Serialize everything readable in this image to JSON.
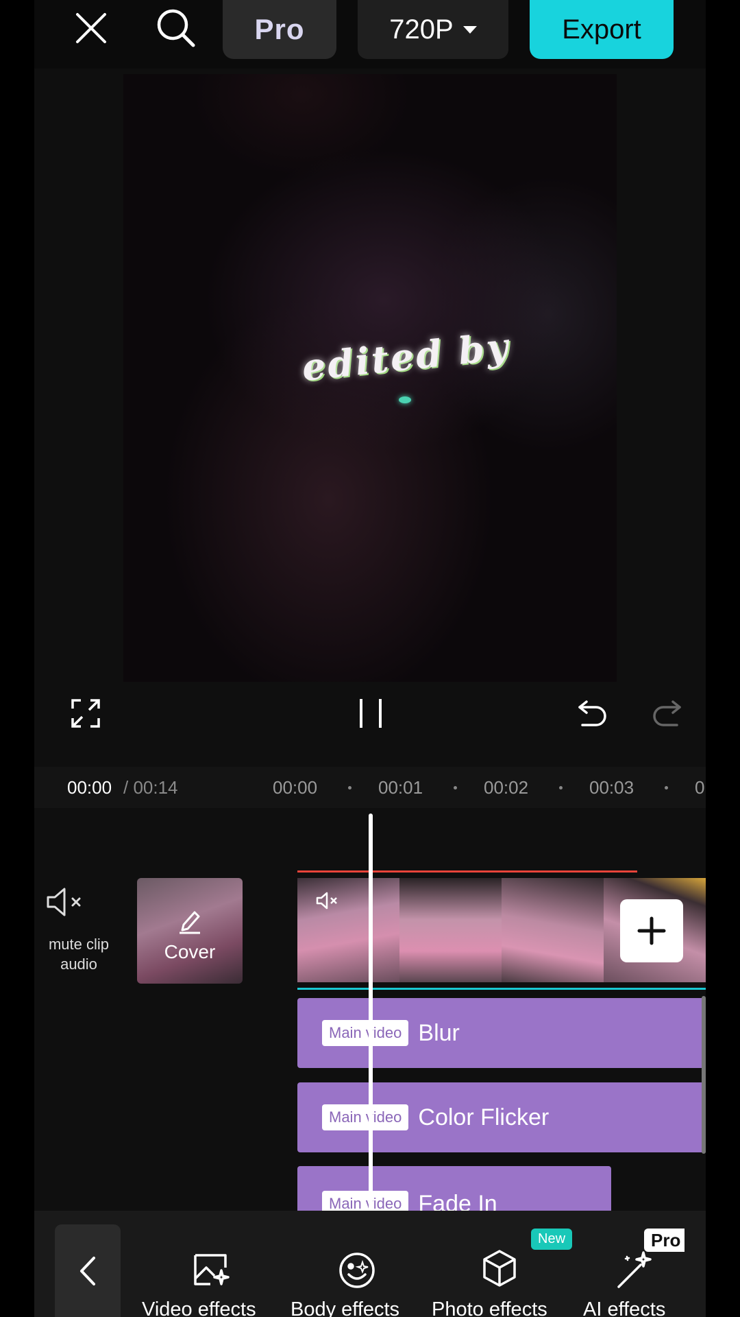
{
  "header": {
    "close_icon": "close-icon",
    "search_icon": "search-icon",
    "pro_label": "Pro",
    "resolution": "720P",
    "export_label": "Export"
  },
  "preview": {
    "overlay_text": "edited by"
  },
  "controls": {
    "fullscreen_icon": "fullscreen-icon",
    "pause_icon": "pause-icon",
    "undo_icon": "undo-icon",
    "redo_icon": "redo-icon"
  },
  "timeline": {
    "current_time": "00:00",
    "total_time": "/ 00:14",
    "ticks": [
      "00:00",
      "00:01",
      "00:02",
      "00:03",
      "0"
    ],
    "mute_label_line1": "mute clip",
    "mute_label_line2": "audio",
    "cover_label": "Cover",
    "effects": [
      {
        "tag": "Main video",
        "name": "Blur"
      },
      {
        "tag": "Main video",
        "name": "Color Flicker"
      },
      {
        "tag": "Main video",
        "name": "Fade In"
      }
    ]
  },
  "toolbar": {
    "items": [
      {
        "label": "Video effects",
        "icon": "video-effects-icon"
      },
      {
        "label": "Body effects",
        "icon": "body-effects-icon"
      },
      {
        "label": "Photo effects",
        "icon": "photo-effects-icon"
      },
      {
        "label": "AI effects",
        "icon": "ai-effects-icon"
      }
    ],
    "new_badge": "New",
    "pro_badge": "Pro"
  },
  "colors": {
    "accent": "#18d3dd",
    "effect_track": "#9a74c8",
    "playhead": "#ffffff",
    "trim_line": "#e8443a"
  }
}
